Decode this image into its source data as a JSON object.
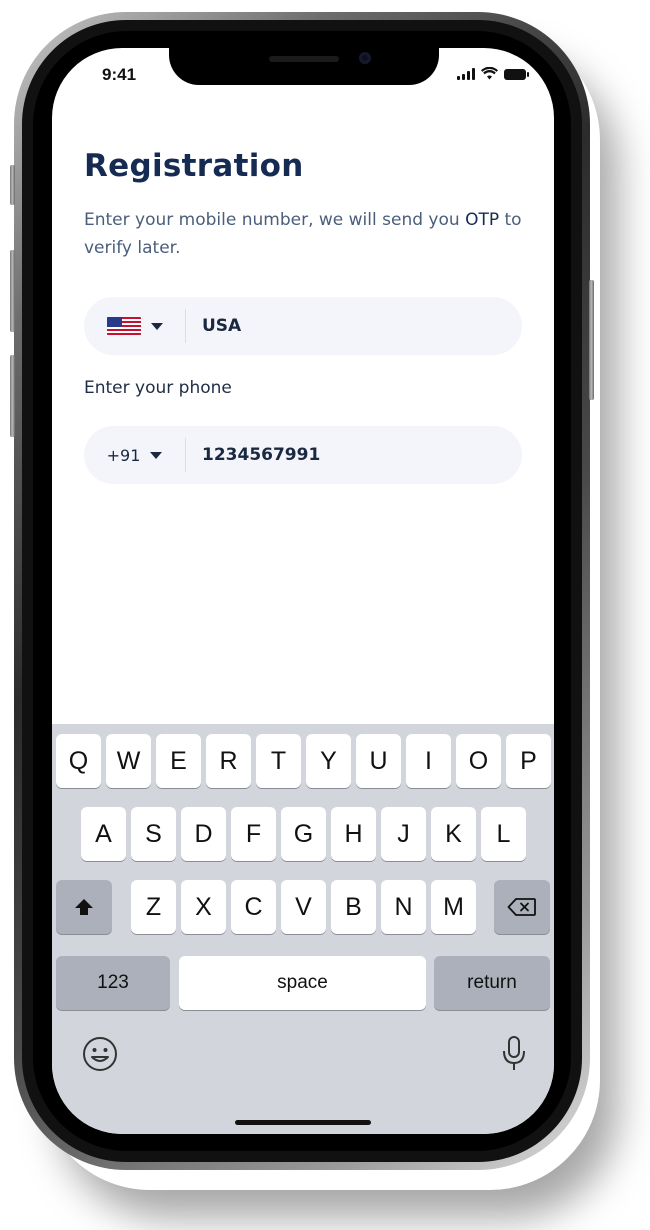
{
  "status_bar": {
    "time": "9:41",
    "signal_icon": "cellular-signal-icon",
    "wifi_icon": "wifi-icon",
    "battery_icon": "battery-icon"
  },
  "registration": {
    "title": "Registration",
    "subtitle_part1": "Enter your mobile number, we will send you ",
    "subtitle_otp": "OTP",
    "subtitle_part2": " to verify later."
  },
  "country_field": {
    "flag_icon": "us-flag-icon",
    "value": "USA"
  },
  "phone_label": "Enter your phone",
  "phone_field": {
    "code": "+91",
    "value": "1234567991"
  },
  "keyboard": {
    "row1": [
      "Q",
      "W",
      "E",
      "R",
      "T",
      "Y",
      "U",
      "I",
      "O",
      "P"
    ],
    "row2": [
      "A",
      "S",
      "D",
      "F",
      "G",
      "H",
      "J",
      "K",
      "L"
    ],
    "row3": [
      "Z",
      "X",
      "C",
      "V",
      "B",
      "N",
      "M"
    ],
    "numbers_key": "123",
    "space_key": "space",
    "return_key": "return",
    "shift_icon": "shift-icon",
    "delete_icon": "backspace-icon",
    "emoji_icon": "emoji-icon",
    "mic_icon": "microphone-icon"
  },
  "colors": {
    "title": "#162b52",
    "subtitle": "#4a5e7c",
    "field_bg": "#f3f5fa",
    "keyboard_bg": "#d2d5db"
  }
}
